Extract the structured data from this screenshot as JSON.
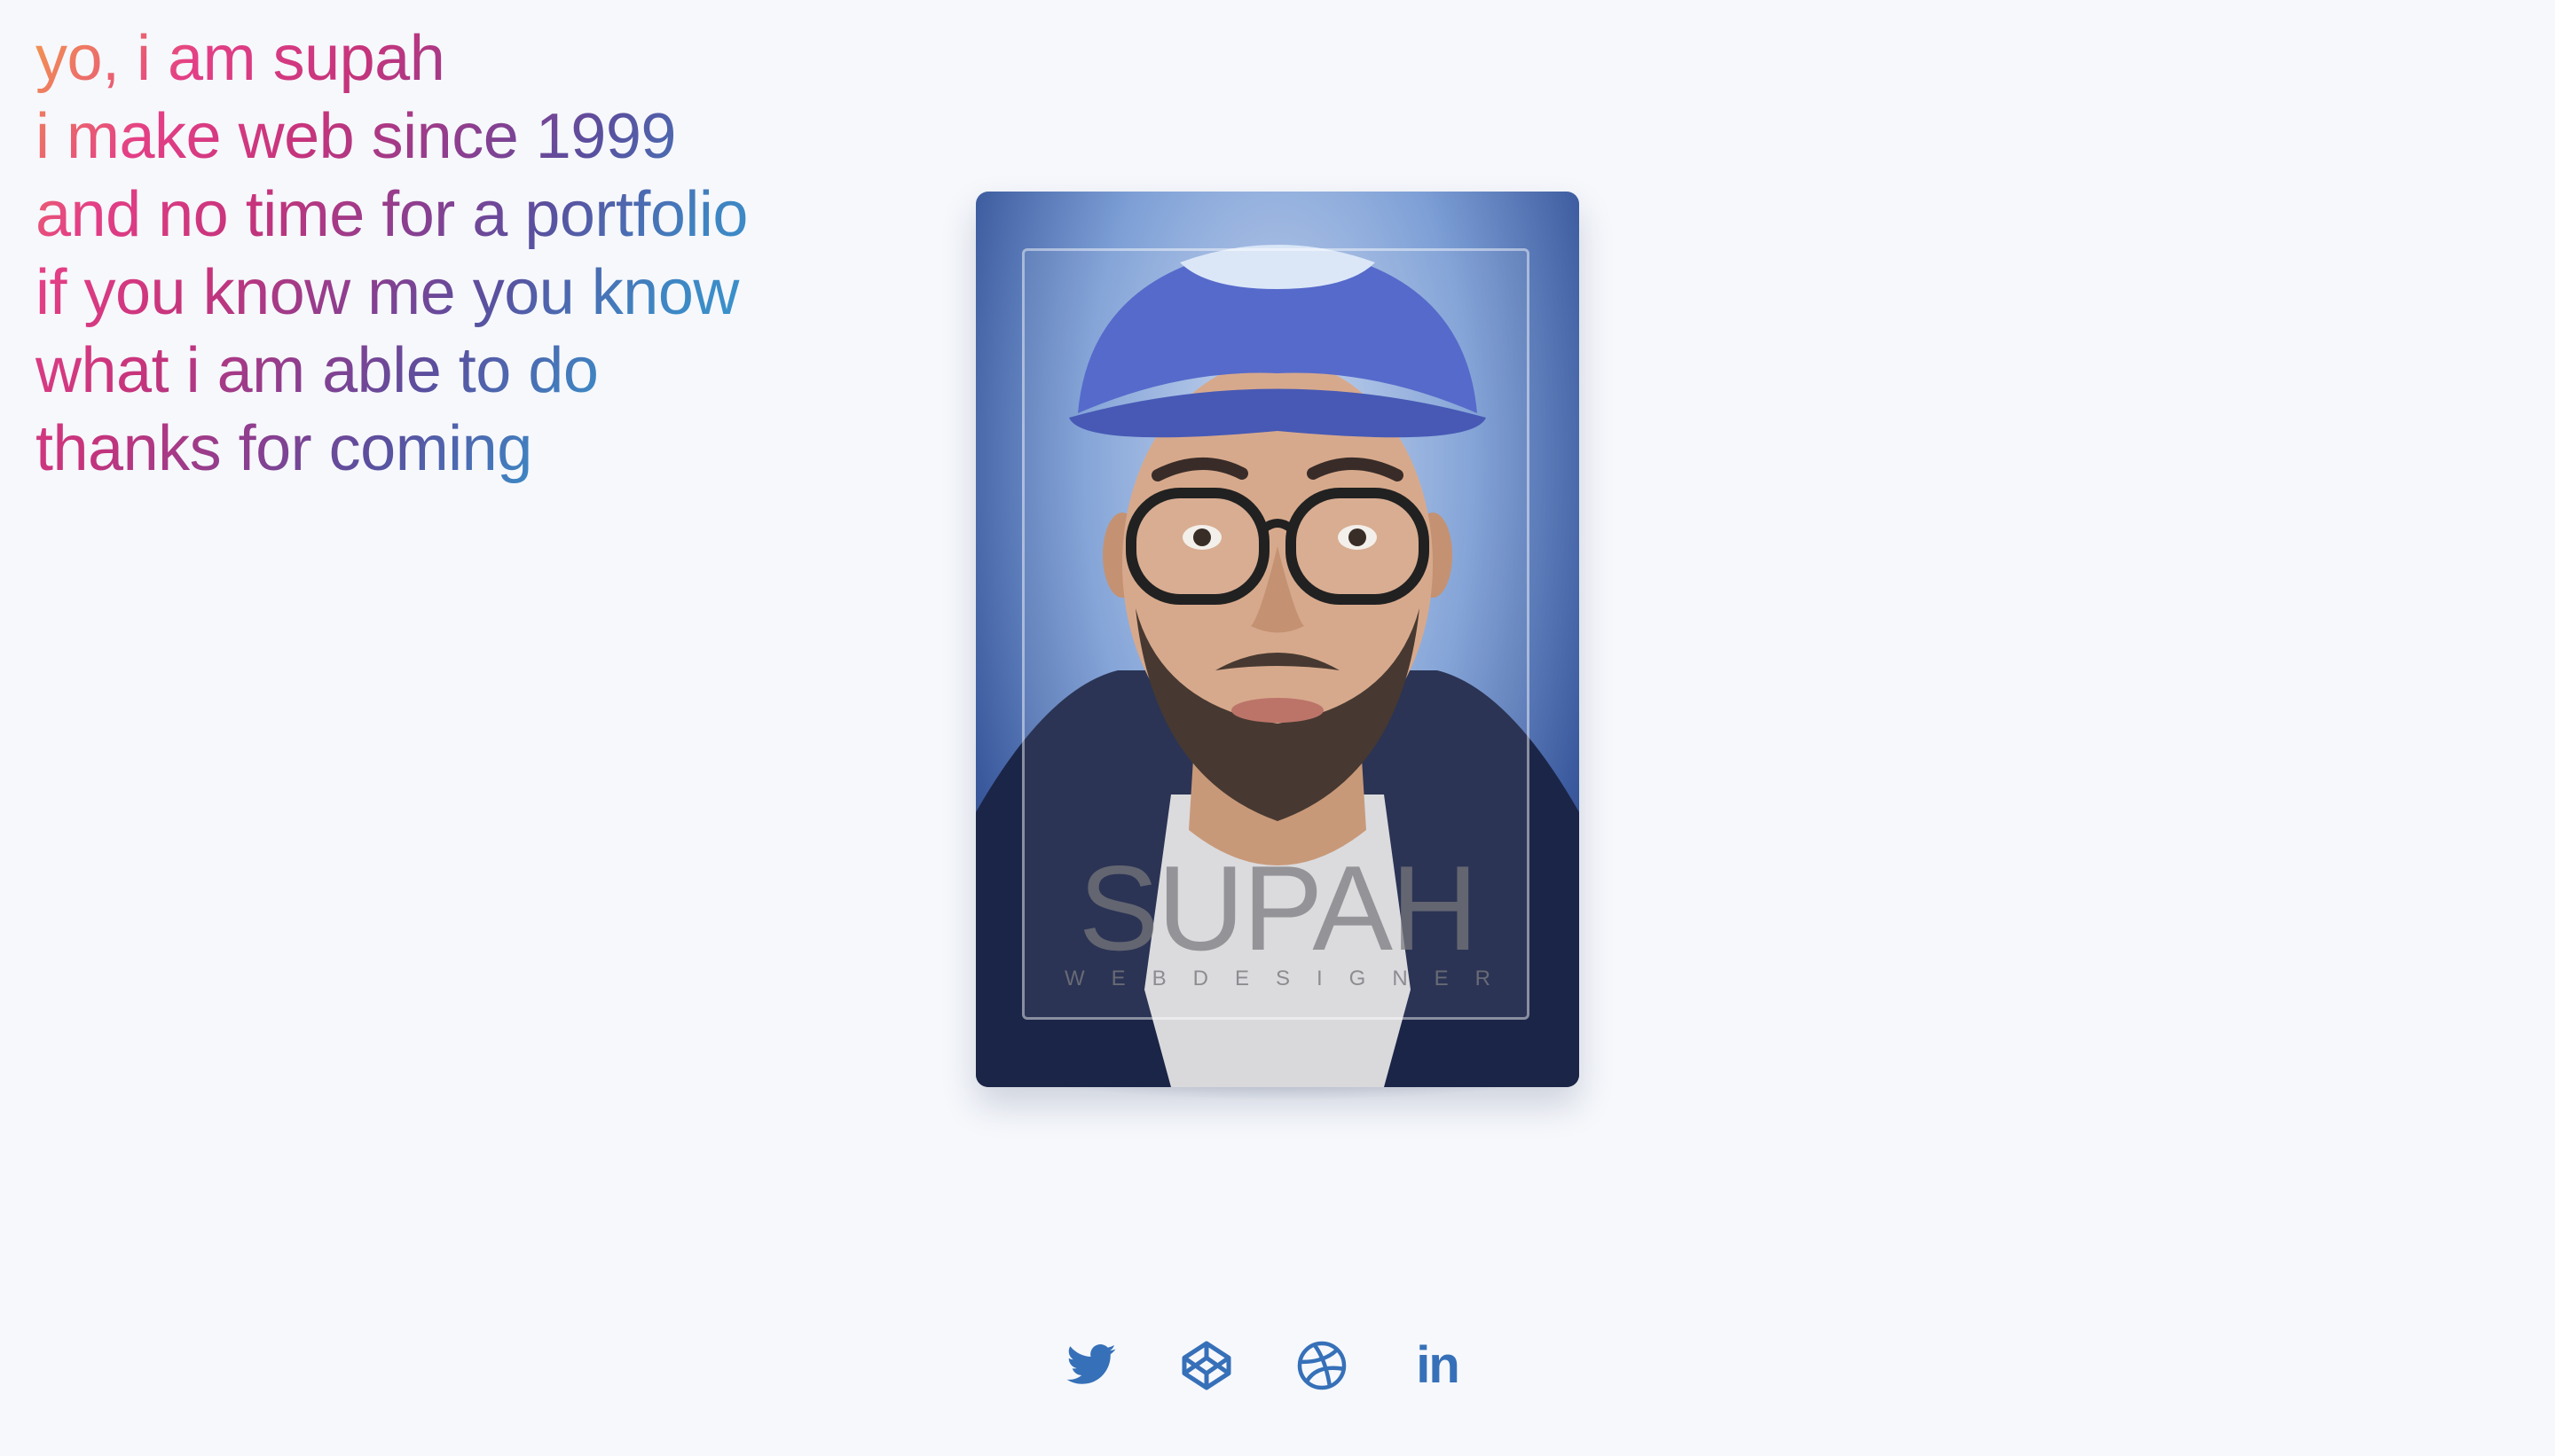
{
  "intro": {
    "lines": [
      "yo, i am supah",
      "i make web since 1999",
      "and no time for a portfolio",
      "if you know me you know",
      "what i am able to do",
      "thanks for coming"
    ]
  },
  "card": {
    "name": "SUPAH",
    "role": "WEBDESIGNER"
  },
  "social": {
    "icons": [
      "twitter-icon",
      "codepen-icon",
      "dribbble-icon",
      "linkedin-icon"
    ],
    "linkedin_text": "in"
  },
  "colors": {
    "background": "#f6f8fc",
    "icon": "#3670b8",
    "gradient_start": "#f39a4e",
    "gradient_mid": "#c6347c",
    "gradient_end": "#32a5d8"
  }
}
